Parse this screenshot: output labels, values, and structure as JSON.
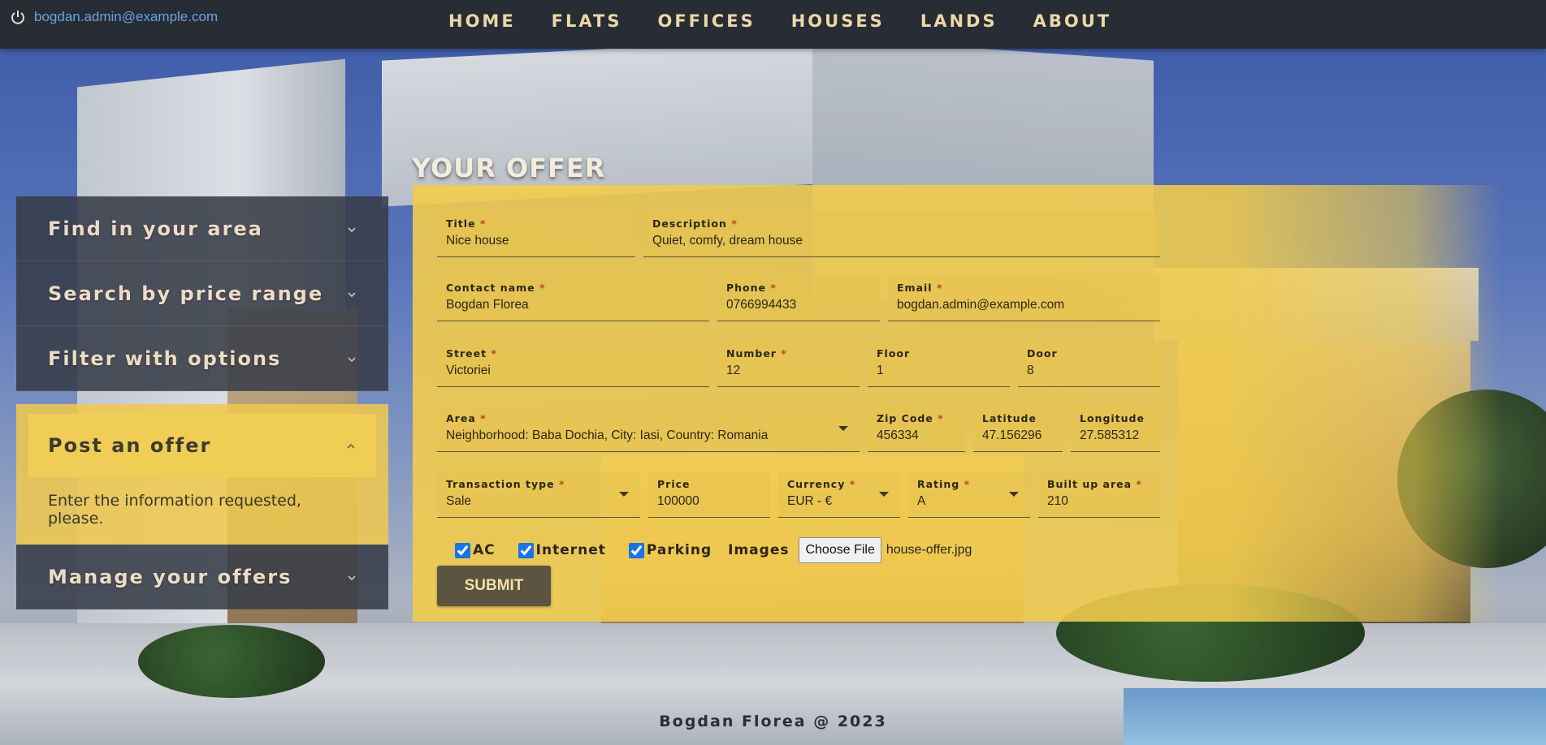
{
  "user": {
    "email": "bogdan.admin@example.com"
  },
  "nav": [
    "HOME",
    "FLATS",
    "OFFICES",
    "HOUSES",
    "LANDS",
    "ABOUT"
  ],
  "sidebar": {
    "items": [
      {
        "title": "Find in your area"
      },
      {
        "title": "Search by price range"
      },
      {
        "title": "Filter with options"
      },
      {
        "title": "Post an offer",
        "body": "Enter the information requested, please."
      },
      {
        "title": "Manage your offers"
      }
    ]
  },
  "offer": {
    "heading": "YOUR OFFER",
    "fields": {
      "title": {
        "label": "Title",
        "value": "Nice house"
      },
      "description": {
        "label": "Description",
        "value": "Quiet, comfy, dream house"
      },
      "contact_name": {
        "label": "Contact name",
        "value": "Bogdan Florea"
      },
      "phone": {
        "label": "Phone",
        "value": "0766994433"
      },
      "email": {
        "label": "Email",
        "value": "bogdan.admin@example.com"
      },
      "street": {
        "label": "Street",
        "value": "Victoriei"
      },
      "number": {
        "label": "Number",
        "value": "12"
      },
      "floor": {
        "label": "Floor",
        "value": "1"
      },
      "door": {
        "label": "Door",
        "value": "8"
      },
      "area": {
        "label": "Area",
        "value": "Neighborhood: Baba Dochia, City: Iasi, Country: Romania"
      },
      "zip": {
        "label": "Zip Code",
        "value": "456334"
      },
      "latitude": {
        "label": "Latitude",
        "value": "47.156296"
      },
      "longitude": {
        "label": "Longitude",
        "value": "27.585312"
      },
      "transaction": {
        "label": "Transaction type",
        "value": "Sale"
      },
      "price": {
        "label": "Price",
        "value": "100000"
      },
      "currency": {
        "label": "Currency",
        "value": "EUR - €"
      },
      "rating": {
        "label": "Rating",
        "value": "A"
      },
      "built_area": {
        "label": "Built up area",
        "value": "210"
      }
    },
    "required_marker": "*",
    "checkboxes": [
      {
        "label": "AC",
        "checked": true
      },
      {
        "label": "Internet",
        "checked": true
      },
      {
        "label": "Parking",
        "checked": true
      }
    ],
    "images_label": "Images",
    "file_button": "Choose File",
    "file_name": "house-offer.jpg",
    "submit": "SUBMIT"
  },
  "footer": "Bogdan Florea @ 2023",
  "colors": {
    "topbar": "#272c35",
    "nav_text": "#ecd7a8",
    "accent_yellow": "#f2cc4c",
    "submit_bg": "#5a5440",
    "link": "#6aa3e0"
  }
}
